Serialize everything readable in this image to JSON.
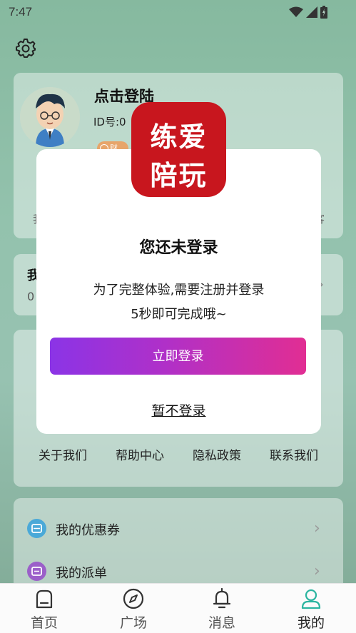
{
  "status_bar": {
    "time": "7:47"
  },
  "profile": {
    "title": "点击登陆",
    "id_label": "ID号:0",
    "badge": "财",
    "left_fragment": "我",
    "right_fragment": "客"
  },
  "wallet": {
    "title": "我",
    "value": "0"
  },
  "services": [
    {
      "label": "关于我们"
    },
    {
      "label": "帮助中心"
    },
    {
      "label": "隐私政策"
    },
    {
      "label": "联系我们"
    }
  ],
  "menu": [
    {
      "label": "我的优惠券",
      "icon": "coupon-icon",
      "color": "#4aa9d8"
    },
    {
      "label": "我的派单",
      "icon": "order-icon",
      "color": "#9b5fc9"
    }
  ],
  "tabs": [
    {
      "label": "首页",
      "icon": "home-icon",
      "active": false
    },
    {
      "label": "广场",
      "icon": "compass-icon",
      "active": false
    },
    {
      "label": "消息",
      "icon": "bell-icon",
      "active": false
    },
    {
      "label": "我的",
      "icon": "user-icon",
      "active": true
    }
  ],
  "modal": {
    "logo_line1": "练爱",
    "logo_line2": "陪玩",
    "title": "您还未登录",
    "line1": "为了完整体验,需要注册并登录",
    "line2": "5秒即可完成哦~",
    "login_button": "立即登录",
    "skip_link": "暂不登录"
  },
  "colors": {
    "accent_teal": "#2bb5a0",
    "logo_red": "#c8161e",
    "button_gradient_start": "#8b34e6",
    "button_gradient_end": "#e12e93"
  }
}
